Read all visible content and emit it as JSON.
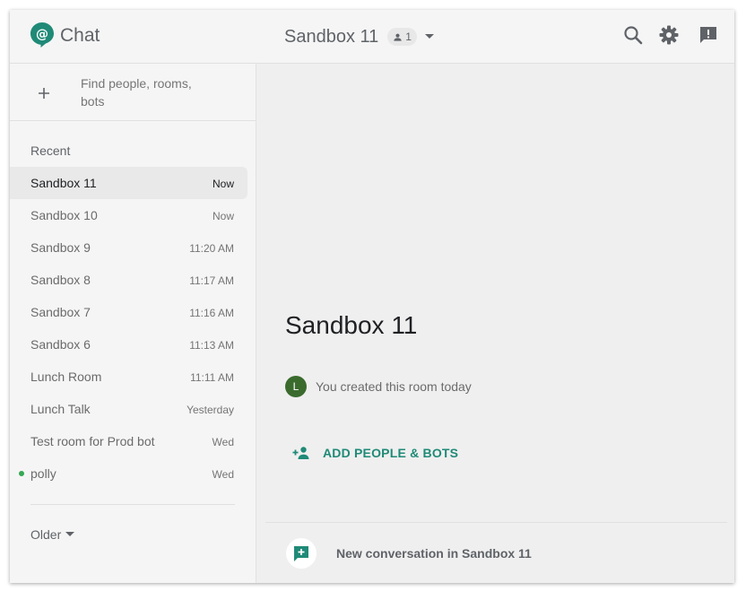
{
  "header": {
    "app_name": "Chat",
    "room_title": "Sandbox 11",
    "member_count": "1",
    "icons": [
      "chat-logo-icon",
      "person-icon",
      "caret-down-icon",
      "search-icon",
      "gear-icon",
      "feedback-icon"
    ]
  },
  "sidebar": {
    "find_placeholder": "Find people, rooms, bots",
    "recent_label": "Recent",
    "rooms": [
      {
        "name": "Sandbox 11",
        "time": "Now",
        "selected": true
      },
      {
        "name": "Sandbox 10",
        "time": "Now"
      },
      {
        "name": "Sandbox 9",
        "time": "11:20 AM"
      },
      {
        "name": "Sandbox 8",
        "time": "11:17 AM"
      },
      {
        "name": "Sandbox 7",
        "time": "11:16 AM"
      },
      {
        "name": "Sandbox 6",
        "time": "11:13 AM"
      },
      {
        "name": "Lunch Room",
        "time": "11:11 AM"
      },
      {
        "name": "Lunch Talk",
        "time": "Yesterday"
      },
      {
        "name": "Test room for Prod bot",
        "time": "Wed"
      },
      {
        "name": "polly",
        "time": "Wed",
        "online": true
      }
    ],
    "older_label": "Older"
  },
  "main": {
    "room_title": "Sandbox 11",
    "avatar_initial": "L",
    "created_text": "You created this room today",
    "add_people_label": "ADD PEOPLE & BOTS",
    "new_conversation_label": "New conversation in Sandbox 11"
  },
  "colors": {
    "accent": "#1f8a77",
    "avatar": "#3a6b2d",
    "online": "#34a853",
    "selected_bg": "#e9e9e9"
  }
}
